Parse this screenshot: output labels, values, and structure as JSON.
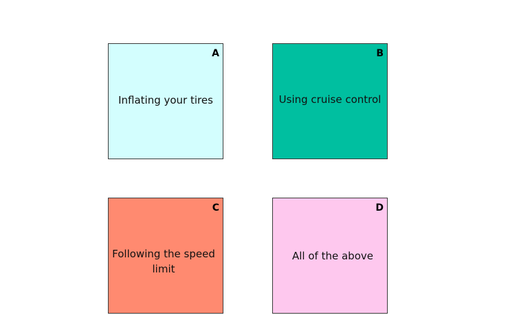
{
  "options": [
    {
      "letter": "A",
      "text": "Inflating your tires",
      "color": "#D3FEFE"
    },
    {
      "letter": "B",
      "text": "Using cruise control",
      "color": "#00BFA0"
    },
    {
      "letter": "C",
      "text": "Following the speed limit",
      "color": "#FF8A70"
    },
    {
      "letter": "D",
      "text": "All of the above",
      "color": "#FEC8EE"
    }
  ]
}
